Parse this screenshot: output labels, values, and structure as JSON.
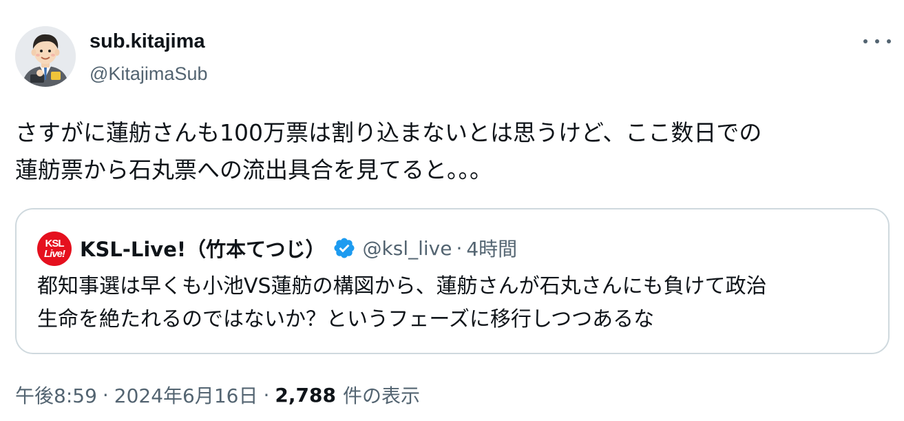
{
  "author": {
    "display_name": "sub.kitajima",
    "handle": "@KitajimaSub",
    "avatar_icon": "businessman-illustration-avatar"
  },
  "more_icon": "more-dots-icon",
  "tweet": {
    "text": "さすがに蓮舫さんも100万票は割り込まないとは思うけど、ここ数日での\n蓮舫票から石丸票への流出具合を見てると。。。"
  },
  "quoted_tweet": {
    "avatar_text_line1": "KSL",
    "avatar_text_line2": "Live!",
    "display_name": "KSL-Live!（竹本てつじ）",
    "verified_icon": "verified-badge-icon",
    "handle": "@ksl_live",
    "separator": "·",
    "time": "4時間",
    "text": "都知事選は早くも小池VS蓮舫の構図から、蓮舫さんが石丸さんにも負けて政治\n生命を絶たれるのではないか？というフェーズに移行しつつあるな"
  },
  "meta": {
    "time": "午後8:59",
    "separator": "·",
    "date": "2024年6月16日",
    "view_count": "2,788",
    "views_label": "件の表示"
  },
  "colors": {
    "text": "#0f1419",
    "secondary": "#536471",
    "border": "#cfd9de",
    "verified": "#1d9bf0",
    "ksl_red": "#e5101e"
  }
}
